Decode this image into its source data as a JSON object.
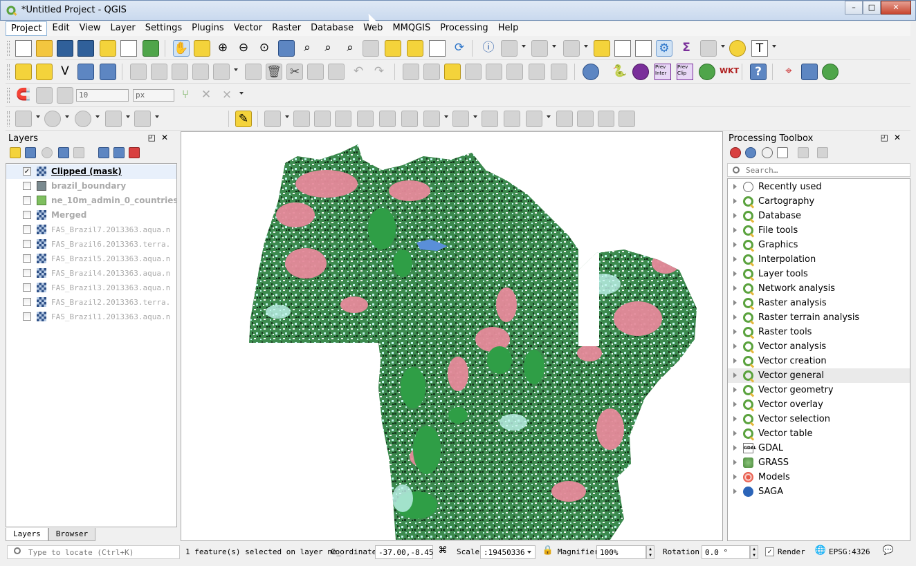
{
  "window": {
    "title": "*Untitled Project - QGIS",
    "min_label": "–",
    "max_label": "□",
    "close_label": "✕"
  },
  "menu": [
    "Project",
    "Edit",
    "View",
    "Layer",
    "Settings",
    "Plugins",
    "Vector",
    "Raster",
    "Database",
    "Web",
    "MMQGIS",
    "Processing",
    "Help"
  ],
  "digitize": {
    "tolerance_value": "10",
    "unit_value": "px"
  },
  "toolbar_text": {
    "prev_inter": "Prev Inter",
    "prev_clip": "Prev Clip",
    "wkt": "WKT",
    "sigma": "Σ",
    "help": "?",
    "text_tool": "T"
  },
  "layers_panel": {
    "title": "Layers",
    "float_label": "◰",
    "close_label": "✕",
    "layers": [
      {
        "name": "Clipped (mask)",
        "checked": true,
        "icon": "raster-icon",
        "selected": true
      },
      {
        "name": "brazil_boundary",
        "checked": false,
        "icon": "polygon-gray-icon"
      },
      {
        "name": "ne_10m_admin_0_countries",
        "checked": false,
        "icon": "polygon-green-icon"
      },
      {
        "name": "Merged",
        "checked": false,
        "icon": "raster-icon"
      },
      {
        "name": "FAS_Brazil7.2013363.aqua.n",
        "checked": false,
        "icon": "raster-icon"
      },
      {
        "name": "FAS_Brazil6.2013363.terra.",
        "checked": false,
        "icon": "raster-icon"
      },
      {
        "name": "FAS_Brazil5.2013363.aqua.n",
        "checked": false,
        "icon": "raster-icon"
      },
      {
        "name": "FAS_Brazil4.2013363.aqua.n",
        "checked": false,
        "icon": "raster-icon"
      },
      {
        "name": "FAS_Brazil3.2013363.aqua.n",
        "checked": false,
        "icon": "raster-icon"
      },
      {
        "name": "FAS_Brazil2.2013363.terra.",
        "checked": false,
        "icon": "raster-icon"
      },
      {
        "name": "FAS_Brazil1.2013363.aqua.n",
        "checked": false,
        "icon": "raster-icon"
      }
    ],
    "tabs": [
      "Layers",
      "Browser"
    ]
  },
  "toolbox": {
    "title": "Processing Toolbox",
    "float_label": "◰",
    "close_label": "✕",
    "search_placeholder": "Search…",
    "groups": [
      {
        "label": "Recently used",
        "icon": "clock-icon"
      },
      {
        "label": "Cartography",
        "icon": "qgis-icon"
      },
      {
        "label": "Database",
        "icon": "qgis-icon"
      },
      {
        "label": "File tools",
        "icon": "qgis-icon"
      },
      {
        "label": "Graphics",
        "icon": "qgis-icon"
      },
      {
        "label": "Interpolation",
        "icon": "qgis-icon"
      },
      {
        "label": "Layer tools",
        "icon": "qgis-icon"
      },
      {
        "label": "Network analysis",
        "icon": "qgis-icon"
      },
      {
        "label": "Raster analysis",
        "icon": "qgis-icon"
      },
      {
        "label": "Raster terrain analysis",
        "icon": "qgis-icon"
      },
      {
        "label": "Raster tools",
        "icon": "qgis-icon"
      },
      {
        "label": "Vector analysis",
        "icon": "qgis-icon"
      },
      {
        "label": "Vector creation",
        "icon": "qgis-icon"
      },
      {
        "label": "Vector general",
        "icon": "qgis-icon",
        "hover": true
      },
      {
        "label": "Vector geometry",
        "icon": "qgis-icon"
      },
      {
        "label": "Vector overlay",
        "icon": "qgis-icon"
      },
      {
        "label": "Vector selection",
        "icon": "qgis-icon"
      },
      {
        "label": "Vector table",
        "icon": "qgis-icon"
      },
      {
        "label": "GDAL",
        "icon": "gdal-icon"
      },
      {
        "label": "GRASS",
        "icon": "grass-icon"
      },
      {
        "label": "Models",
        "icon": "models-icon"
      },
      {
        "label": "SAGA",
        "icon": "saga-icon"
      }
    ],
    "gdal_icon_text": "GDAL"
  },
  "statusbar": {
    "locate_placeholder": "Type to locate (Ctrl+K)",
    "message": "1 feature(s) selected on layer ne_",
    "coordinate_label": "Coordinate",
    "coordinate_value": "-37.00,-8.45",
    "scale_label": "Scale",
    "scale_value": ":19450336",
    "magnifier_label": "Magnifier",
    "magnifier_value": "100%",
    "rotation_label": "Rotation",
    "rotation_value": "0.0 °",
    "render_label": "Render",
    "render_checked": true,
    "crs_label": "EPSG:4326"
  },
  "colors": {
    "forest_green": "#2f9e46",
    "dark_veg": "#1b3d22",
    "pink": "#e58a9a",
    "light_cyan": "#bff3ec",
    "water_blue": "#5a8fd8",
    "accent": "#5aa23d"
  }
}
